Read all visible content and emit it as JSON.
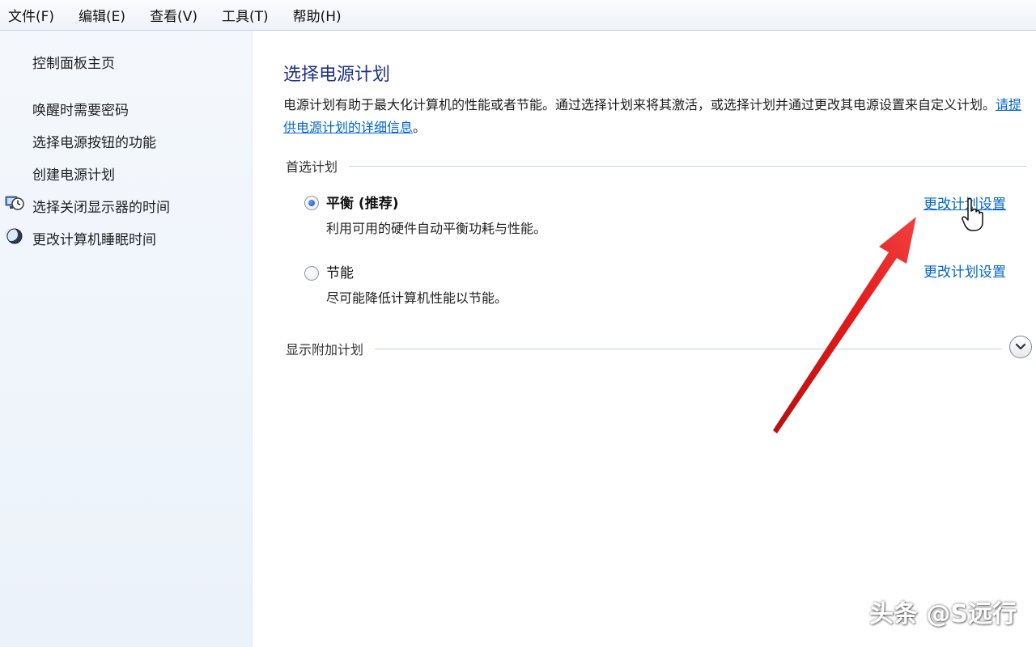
{
  "menubar": {
    "items": [
      "文件(F)",
      "编辑(E)",
      "查看(V)",
      "工具(T)",
      "帮助(H)"
    ]
  },
  "sidebar": {
    "home": "控制面板主页",
    "links": [
      {
        "label": "唤醒时需要密码",
        "icon": ""
      },
      {
        "label": "选择电源按钮的功能",
        "icon": ""
      },
      {
        "label": "创建电源计划",
        "icon": ""
      },
      {
        "label": "选择关闭显示器的时间",
        "icon": "display-clock-icon"
      },
      {
        "label": "更改计算机睡眠时间",
        "icon": "moon-sleep-icon"
      }
    ]
  },
  "main": {
    "title": "选择电源计划",
    "description": "电源计划有助于最大化计算机的性能或者节能。通过选择计划来将其激活，或选择计划并通过更改其电源设置来自定义计划。",
    "description_link": "请提供电源计划的详细信息",
    "description_end": "。",
    "preferred_section": "首选计划",
    "plans": [
      {
        "name": "平衡 (推荐)",
        "description": "利用可用的硬件自动平衡功耗与性能。",
        "selected": true,
        "change_link": "更改计划设置"
      },
      {
        "name": "节能",
        "description": "尽可能降低计算机性能以节能。",
        "selected": false,
        "change_link": "更改计划设置"
      }
    ],
    "additional_section": "显示附加计划"
  },
  "watermark": "头条 @S远行",
  "colors": {
    "title": "#1e3287",
    "link": "#0066cc",
    "annotation_arrow": "#e01b1b",
    "sidebar_bg": "#eef3fa"
  }
}
